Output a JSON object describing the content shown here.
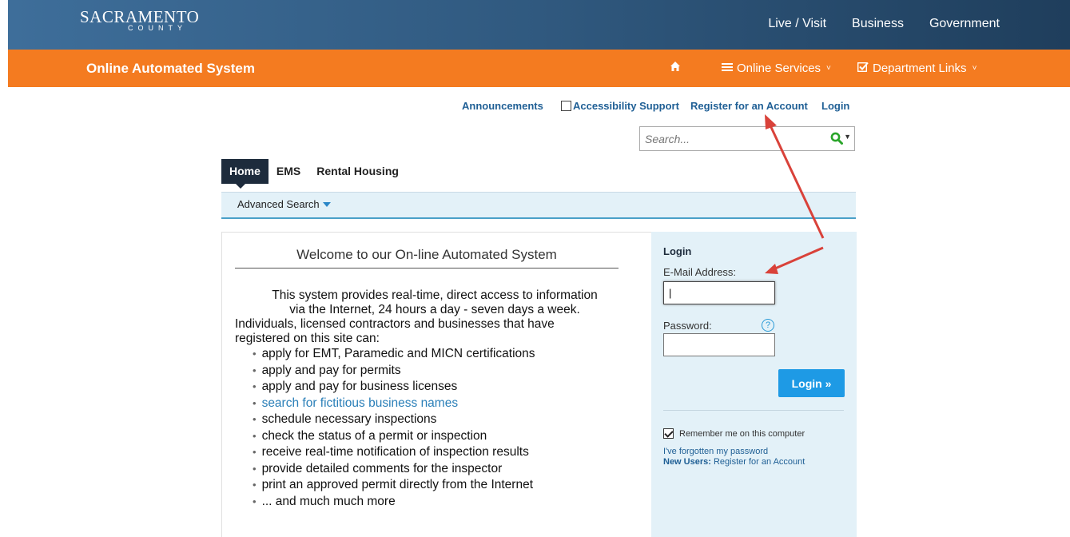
{
  "header": {
    "logo_main": "SACRAMENTO",
    "logo_sub": "COUNTY",
    "nav": [
      "Live / Visit",
      "Business",
      "Government"
    ]
  },
  "orange_bar": {
    "title": "Online Automated System",
    "online_services": "Online Services",
    "department_links": "Department Links"
  },
  "utility": {
    "announcements": "Announcements",
    "accessibility": "Accessibility Support",
    "register": "Register for an Account",
    "login": "Login"
  },
  "search": {
    "placeholder": "Search..."
  },
  "tabs": [
    "Home",
    "EMS",
    "Rental Housing"
  ],
  "advanced_search": "Advanced Search",
  "welcome": {
    "title": "Welcome to our On-line Automated System",
    "intro_line1": "This system provides real-time, direct access to information",
    "intro_line2": "via the Internet, 24 hours a day - seven days a week.",
    "intro_line3": "Individuals, licensed contractors and businesses that have",
    "intro_line4": "registered on this site can:",
    "bullets": [
      "apply for EMT, Paramedic and MICN certifications",
      "apply and pay for permits",
      "apply and pay for business licenses",
      "search for fictitious business names",
      "schedule necessary inspections",
      "check the status of a permit or inspection",
      "receive real-time notification of inspection results",
      "provide detailed comments for the inspector",
      "print an approved permit directly from the Internet",
      "... and much much more"
    ]
  },
  "login_panel": {
    "title": "Login",
    "email_label": "E-Mail Address:",
    "email_value": "|",
    "password_label": "Password:",
    "help": "?",
    "login_button": "Login »",
    "remember": "Remember me on this computer",
    "forgot": "I've forgotten my password",
    "new_users_label": "New Users:",
    "new_users_link": "Register for an Account"
  },
  "colors": {
    "orange": "#f47b20",
    "navy": "#1d2b3c",
    "link": "#1f5f95",
    "button": "#1e9ae5",
    "arrow": "#d9423a"
  }
}
